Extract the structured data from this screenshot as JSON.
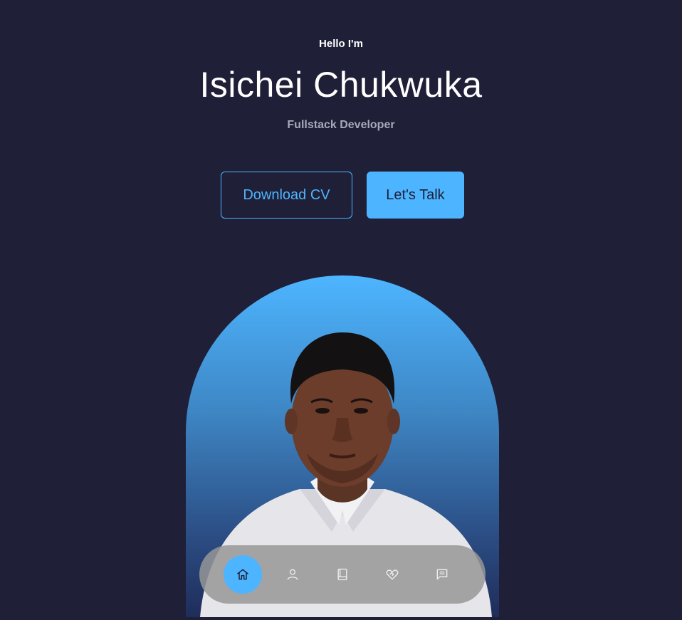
{
  "hero": {
    "greeting": "Hello I'm",
    "name": "Isichei Chukwuka",
    "role": "Fullstack Developer"
  },
  "actions": {
    "download_cv_label": "Download CV",
    "lets_talk_label": "Let's Talk"
  },
  "nav": {
    "items": [
      {
        "icon": "home-icon",
        "active": true
      },
      {
        "icon": "user-icon",
        "active": false
      },
      {
        "icon": "book-icon",
        "active": false
      },
      {
        "icon": "services-icon",
        "active": false
      },
      {
        "icon": "message-icon",
        "active": false
      }
    ]
  },
  "colors": {
    "background": "#1f1f38",
    "accent": "#4db5ff",
    "text": "#ffffff",
    "muted": "#a8a8b8"
  }
}
